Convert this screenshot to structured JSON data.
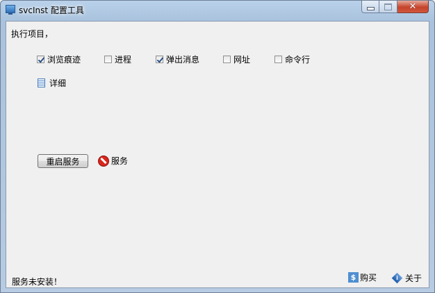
{
  "window": {
    "title": "svcInst 配置工具",
    "controls": {
      "minimize_icon": "minimize-icon",
      "maximize_icon": "maximize-icon",
      "close_glyph": "✕"
    }
  },
  "section": {
    "label": "执行项目，"
  },
  "options": [
    {
      "label": "浏览痕迹",
      "checked": true
    },
    {
      "label": "进程",
      "checked": false
    },
    {
      "label": "弹出消息",
      "checked": true
    },
    {
      "label": "网址",
      "checked": false
    },
    {
      "label": "命令行",
      "checked": false
    }
  ],
  "detail": {
    "label": "详细",
    "icon": "list-icon"
  },
  "service": {
    "restart_label": "重启服务",
    "status_label": "服务",
    "status_icon": "stop-icon",
    "status_color": "#d9261c"
  },
  "footer": {
    "status": "服务未安装！",
    "buy_label": "购买",
    "buy_icon_glyph": "$",
    "about_label": "关于",
    "about_icon_glyph": "i"
  }
}
